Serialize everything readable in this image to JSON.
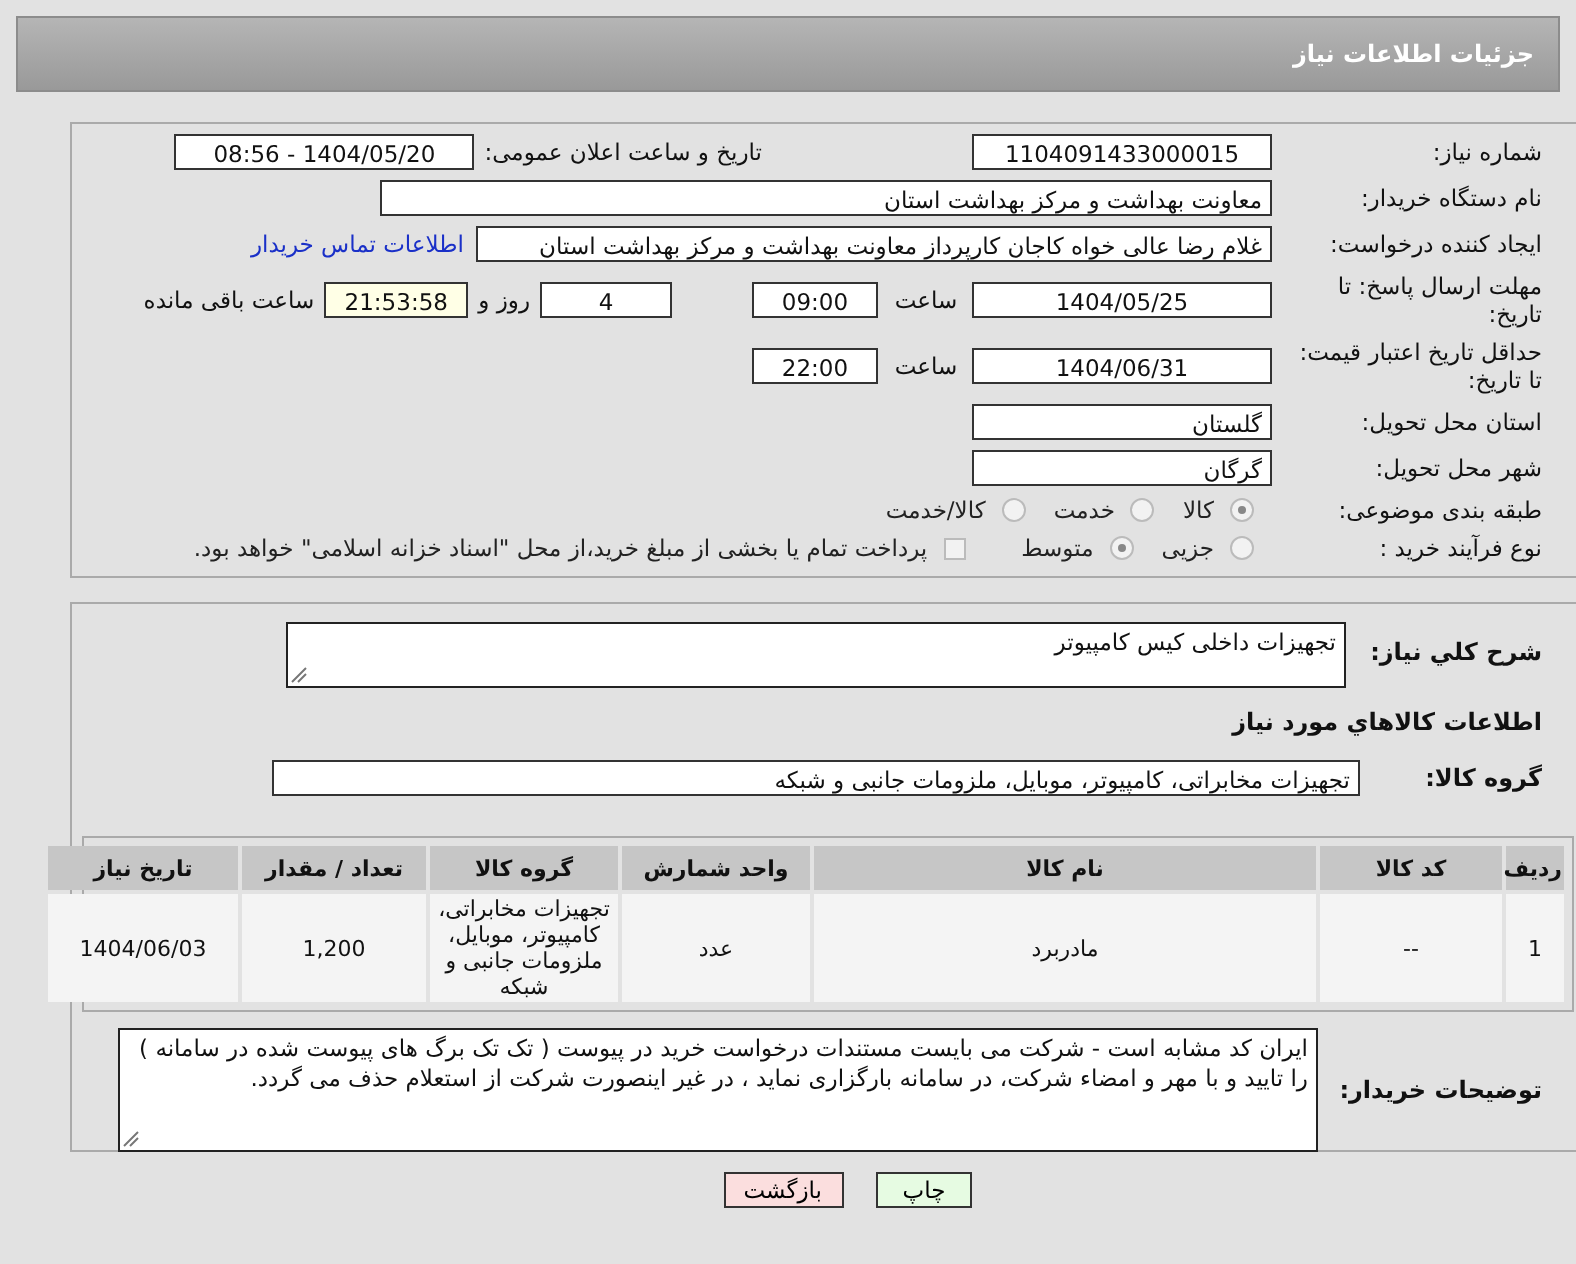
{
  "header": {
    "title": "جزئیات اطلاعات نیاز"
  },
  "need_number": {
    "label": "شماره نیاز:",
    "value": "1104091433000015"
  },
  "announce": {
    "label": "تاریخ و ساعت اعلان عمومی:",
    "value": "1404/05/20 - 08:56"
  },
  "buyer_org": {
    "label": "نام دستگاه خریدار:",
    "value": "معاونت  بهداشت و مرکز بهداشت استان"
  },
  "creator": {
    "label": "ایجاد کننده درخواست:",
    "value": "غلام رضا عالی خواه کاجان کارپرداز معاونت  بهداشت و مرکز بهداشت استان",
    "link": "اطلاعات تماس خریدار"
  },
  "response_deadline": {
    "label": "مهلت ارسال پاسخ: تا تاریخ:",
    "date": "1404/05/25",
    "time_label": "ساعت",
    "time": "09:00",
    "days": "4",
    "days_label": "روز و",
    "remaining": "21:53:58",
    "remaining_label": "ساعت باقی مانده"
  },
  "price_validity": {
    "label": "حداقل تاریخ اعتبار قیمت: تا تاریخ:",
    "date": "1404/06/31",
    "time_label": "ساعت",
    "time": "22:00"
  },
  "province": {
    "label": "استان محل تحویل:",
    "value": "گلستان"
  },
  "city": {
    "label": "شهر محل تحویل:",
    "value": "گرگان"
  },
  "category": {
    "label": "طبقه بندی موضوعی:",
    "options": [
      {
        "label": "کالا",
        "selected": true
      },
      {
        "label": "خدمت",
        "selected": false
      },
      {
        "label": "کالا/خدمت",
        "selected": false
      }
    ]
  },
  "purchase_type": {
    "label": "نوع فرآیند خرید :",
    "options": [
      {
        "label": "جزیی",
        "selected": false
      },
      {
        "label": "متوسط",
        "selected": true
      }
    ],
    "treasury": {
      "label": "پرداخت تمام یا بخشی از مبلغ خرید،از محل \"اسناد خزانه اسلامی\" خواهد بود.",
      "checked": false
    }
  },
  "description": {
    "label": "شرح کلي نياز:",
    "value": "تجهیزات داخلی کیس کامپیوتر"
  },
  "goods_heading": "اطلاعات کالاهاي مورد نياز",
  "goods_group": {
    "label": "گروه کالا:",
    "value": "تجهیزات مخابراتی، کامپیوتر، موبایل، ملزومات جانبی و شبکه"
  },
  "table": {
    "columns": [
      "ردیف",
      "کد کالا",
      "نام کالا",
      "واحد شمارش",
      "گروه کالا",
      "تعداد / مقدار",
      "تاریخ نیاز"
    ],
    "rows": [
      [
        "1",
        "--",
        "مادربرد",
        "عدد",
        "تجهیزات مخابراتی، کامپیوتر، موبایل، ملزومات جانبی و شبکه",
        "1,200",
        "1404/06/03"
      ]
    ]
  },
  "buyer_notes": {
    "label": "توضیحات خریدار:",
    "value": "ایران کد مشابه است -  شرکت می بایست مستندات  درخواست خرید در پیوست ( تک تک  برگ های پیوست شده در سامانه ) را تایید و با مهر و امضاء شرکت،  در سامانه بارگزاری نماید ، در غیر اینصورت شرکت از استعلام حذف می گردد."
  },
  "buttons": [
    {
      "label": "چاپ",
      "kind": "print"
    },
    {
      "label": "بازگشت",
      "kind": "back"
    }
  ]
}
